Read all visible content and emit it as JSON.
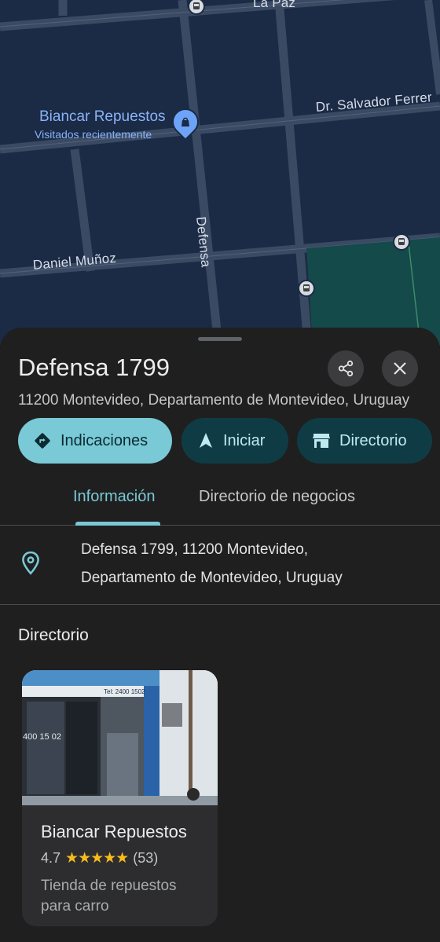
{
  "map": {
    "streets": {
      "la_paz": "La Paz",
      "salvador_ferrer": "Dr. Salvador Ferrer",
      "defensa": "Defensa",
      "daniel_munoz": "Daniel Muñoz"
    },
    "poi": {
      "name": "Biancar Repuestos",
      "subtitle": "Visitados recientemente"
    }
  },
  "place": {
    "title": "Defensa 1799",
    "address": "11200 Montevideo, Departamento de Montevideo, Uruguay"
  },
  "actions": {
    "directions": "Indicaciones",
    "start": "Iniciar",
    "directory": "Directorio"
  },
  "tabs": [
    {
      "label": "Información",
      "active": true
    },
    {
      "label": "Directorio de negocios",
      "active": false
    }
  ],
  "info": {
    "address_line1": "Defensa 1799, 11200 Montevideo,",
    "address_line2": "Departamento de Montevideo, Uruguay"
  },
  "directory": {
    "title": "Directorio",
    "card": {
      "name": "Biancar Repuestos",
      "rating": "4.7",
      "stars": "★★★★★",
      "reviews": "(53)",
      "category": "Tienda de repuestos para carro",
      "photo_text": "400 15 02",
      "photo_sign": "Tel: 2400 1502"
    }
  },
  "colors": {
    "accent": "#79c9d6",
    "map_bg": "#1b2a45",
    "sheet_bg": "#1f1f1f",
    "star": "#f6bb1d"
  }
}
